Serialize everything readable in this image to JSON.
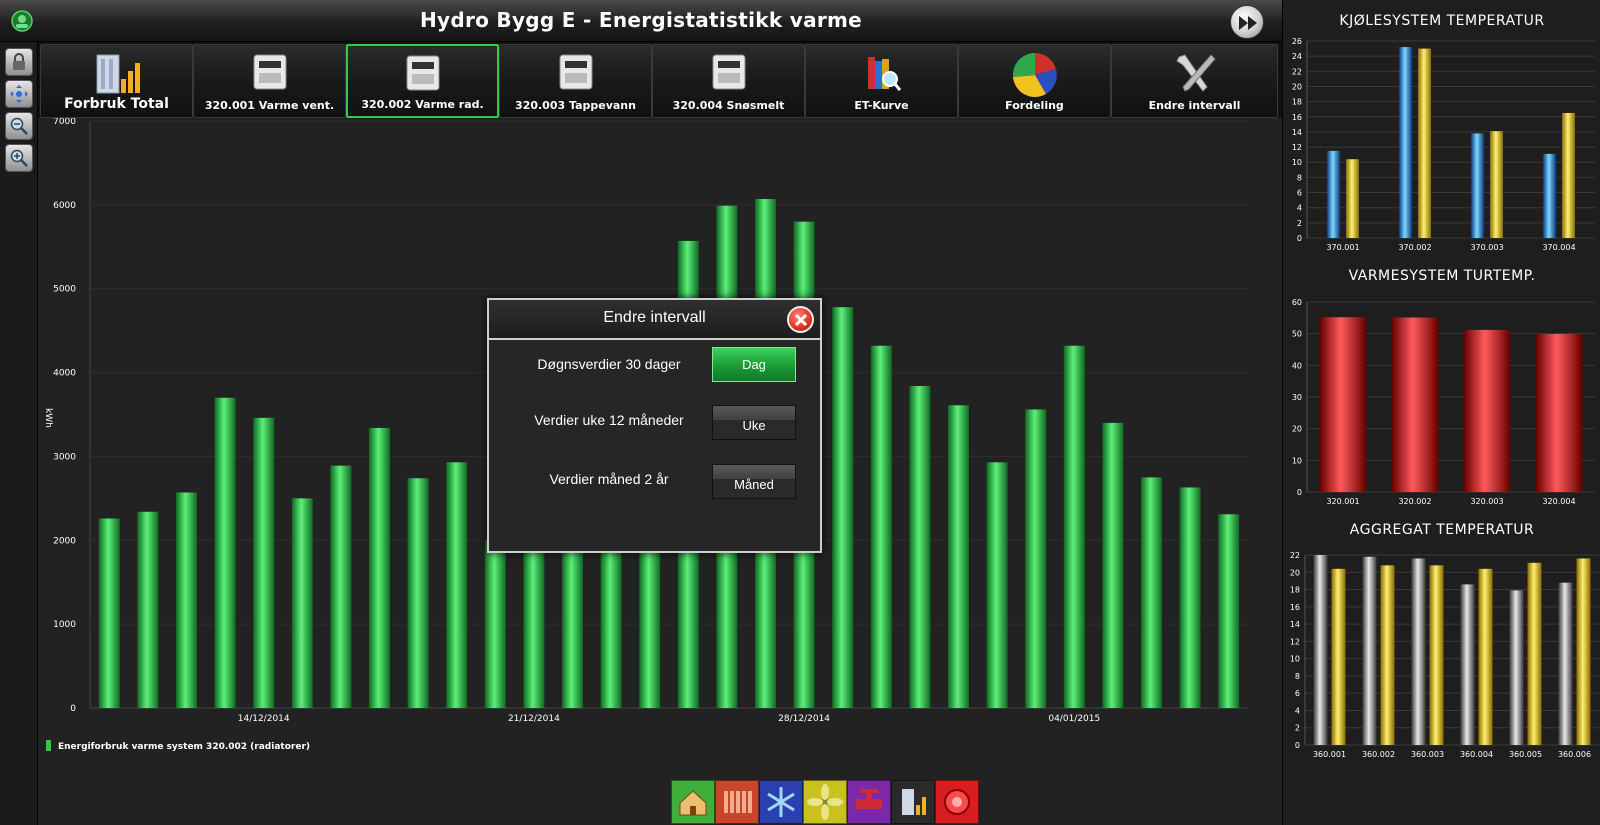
{
  "app": {
    "title": "Hydro Bygg E - Energistatistikk varme"
  },
  "toolbar": {
    "items": [
      {
        "label": "Forbruk Total",
        "icon": "building-bar-chart-icon",
        "active": false
      },
      {
        "label": "320.001 Varme vent.",
        "icon": "energy-meter-icon",
        "active": false
      },
      {
        "label": "320.002 Varme rad.",
        "icon": "energy-meter-icon",
        "active": true
      },
      {
        "label": "320.003 Tappevann",
        "icon": "energy-meter-icon",
        "active": false
      },
      {
        "label": "320.004 Snøsmelt",
        "icon": "energy-meter-icon",
        "active": false
      },
      {
        "label": "ET-Kurve",
        "icon": "books-magnifier-icon",
        "active": false
      },
      {
        "label": "Fordeling",
        "icon": "pie-chart-icon",
        "active": false
      },
      {
        "label": "Endre intervall",
        "icon": "tools-icon",
        "active": false
      }
    ]
  },
  "left_tools": [
    {
      "icon": "lock-icon"
    },
    {
      "icon": "fit-view-icon"
    },
    {
      "icon": "zoom-out-icon"
    },
    {
      "icon": "zoom-in-icon"
    }
  ],
  "modal": {
    "title": "Endre intervall",
    "rows": [
      {
        "label": "Døgnsverdier 30 dager",
        "button": "Dag",
        "selected": true
      },
      {
        "label": "Verdier uke 12 måneder",
        "button": "Uke",
        "selected": false
      },
      {
        "label": "Verdier måned 2 år",
        "button": "Måned",
        "selected": false
      }
    ]
  },
  "puzzle": {
    "pieces": [
      {
        "icon": "house-icon",
        "color": "#3fae3a"
      },
      {
        "icon": "radiator-icon",
        "color": "#c8452a"
      },
      {
        "icon": "snowflake-icon",
        "color": "#2a3fb0"
      },
      {
        "icon": "fan-icon",
        "color": "#c9c21e"
      },
      {
        "icon": "valve-icon",
        "color": "#7a2aa8"
      },
      {
        "icon": "meter-icon",
        "color": "#2a2a2a"
      },
      {
        "icon": "alarm-icon",
        "color": "#d81e1e"
      }
    ]
  },
  "chart_data": [
    {
      "type": "bar",
      "ylabel": "kWh",
      "ylim": [
        0,
        7000
      ],
      "yticks": [
        0,
        1000,
        2000,
        3000,
        4000,
        5000,
        6000,
        7000
      ],
      "x_tick_labels": [
        {
          "label": "14/12/2014",
          "index": 4
        },
        {
          "label": "21/12/2014",
          "index": 11
        },
        {
          "label": "28/12/2014",
          "index": 18
        },
        {
          "label": "04/01/2015",
          "index": 25
        }
      ],
      "values": [
        2260,
        2340,
        2570,
        3700,
        3460,
        2500,
        2890,
        3340,
        2740,
        2930,
        2000,
        2000,
        2000,
        2000,
        2000,
        5570,
        5990,
        6070,
        5800,
        4780,
        4320,
        3840,
        3610,
        2930,
        3560,
        4320,
        3400,
        2750,
        2630,
        2310
      ],
      "grid": true,
      "color": "#2ecc40",
      "legend": {
        "label": "Energiforbruk varme system 320.002 (radiatorer)",
        "placement": "bottom-left"
      }
    },
    {
      "type": "bar",
      "title": "KJØLESYSTEM TEMPERATUR",
      "categories": [
        "370.001",
        "370.002",
        "370.003",
        "370.004"
      ],
      "ylim": [
        0,
        26
      ],
      "yticks": [
        0,
        2,
        4,
        6,
        8,
        10,
        12,
        14,
        16,
        18,
        20,
        22,
        24,
        26
      ],
      "series": [
        {
          "values": [
            11.5,
            25.2,
            13.8,
            11.1
          ],
          "color": "#2aa8f0"
        },
        {
          "values": [
            10.4,
            25.0,
            14.1,
            16.5
          ],
          "color": "#2aa8f0",
          "accent": "#f2c220"
        }
      ],
      "grid": true
    },
    {
      "type": "bar",
      "title": "VARMESYSTEM TURTEMP.",
      "categories": [
        "320.001",
        "320.002",
        "320.003",
        "320.004"
      ],
      "ylim": [
        0,
        60
      ],
      "yticks": [
        0,
        10,
        20,
        30,
        40,
        50,
        60
      ],
      "values": [
        55.2,
        55.1,
        51.2,
        49.9
      ],
      "color": "#e02020",
      "grid": true
    },
    {
      "type": "bar",
      "title": "AGGREGAT TEMPERATUR",
      "categories": [
        "360.001",
        "360.002",
        "360.003",
        "360.004",
        "360.005",
        "360.006"
      ],
      "ylim": [
        0,
        22
      ],
      "yticks": [
        0,
        2,
        4,
        6,
        8,
        10,
        12,
        14,
        16,
        18,
        20,
        22
      ],
      "series": [
        {
          "values": [
            22.0,
            21.8,
            21.6,
            18.6,
            17.9,
            18.8
          ],
          "color": "#9a9a9a"
        },
        {
          "values": [
            20.4,
            20.8,
            20.8,
            20.4,
            21.1,
            21.6
          ],
          "color": "#f2c220"
        }
      ],
      "grid": true
    }
  ]
}
